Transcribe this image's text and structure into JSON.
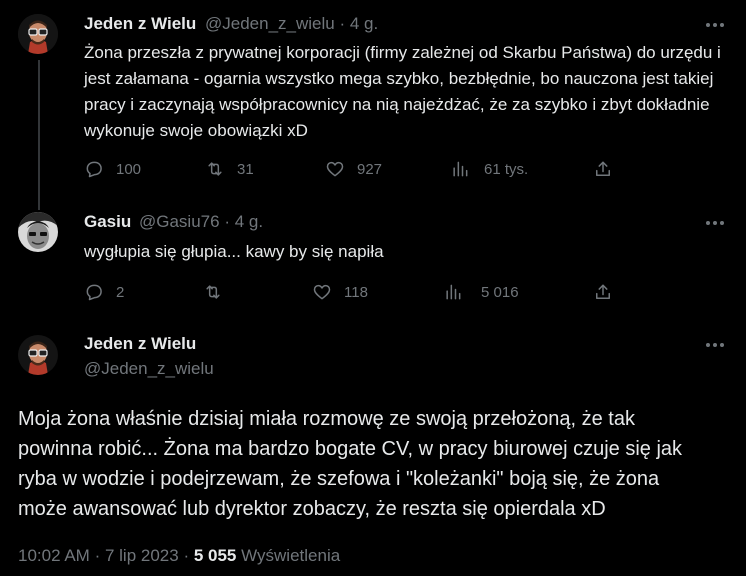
{
  "tweets": [
    {
      "author": "Jeden z Wielu",
      "handle": "@Jeden_z_wielu",
      "sep": "·",
      "age": "4 g.",
      "text": "Żona przeszła z prywatnej korporacji (firmy zależnej od Skarbu Państwa) do urzędu i jest załamana - ogarnia wszystko mega szybko, bezbłędnie, bo nauczona jest takiej pracy i zaczynają współpracownicy na nią najeżdżać, że za szybko i zbyt dokładnie wykonuje swoje obowiązki xD",
      "replies": "100",
      "retweets": "31",
      "likes": "927",
      "views": "61 tys."
    },
    {
      "author": "Gasiu",
      "handle": "@Gasiu76",
      "sep": "·",
      "age": "4 g.",
      "text": "wygłupia się głupia... kawy by się napiła",
      "replies": "2",
      "retweets": "",
      "likes": "118",
      "views": "5 016"
    }
  ],
  "main_tweet": {
    "author": "Jeden z Wielu",
    "handle": "@Jeden_z_wielu",
    "text": "Moja żona właśnie dzisiaj miała rozmowę ze swoją przełożoną, że tak powinna robić... Żona ma bardzo bogate CV, w pracy biurowej czuje się jak ryba w wodzie i podejrzewam, że szefowa i \"koleżanki\" boją się, że żona może awansować lub dyrektor zobaczy, że reszta się opierdala xD",
    "time": "10:02 AM",
    "sep1": "·",
    "date": "7 lip 2023",
    "sep2": "·",
    "views_count": "5 055",
    "views_label": "Wyświetlenia"
  },
  "icons": [
    "reply-icon",
    "retweet-icon",
    "like-icon",
    "views-icon",
    "share-icon",
    "more-icon"
  ],
  "colors": {
    "background": "#000000",
    "text": "#e7e9ea",
    "muted": "#71767b",
    "thread_line": "#333639"
  }
}
